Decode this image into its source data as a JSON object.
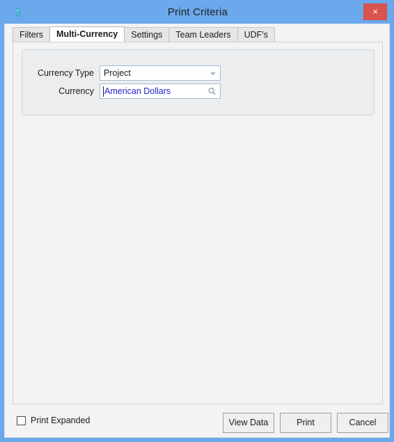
{
  "window": {
    "title": "Print Criteria",
    "app_icon": "bird-icon",
    "close_label": "×",
    "accent_color": "#6ba8ec",
    "close_color": "#d9534f"
  },
  "tabs": [
    {
      "label": "Filters",
      "active": false
    },
    {
      "label": "Multi-Currency",
      "active": true
    },
    {
      "label": "Settings",
      "active": false
    },
    {
      "label": "Team Leaders",
      "active": false
    },
    {
      "label": "UDF's",
      "active": false
    }
  ],
  "form": {
    "currency_type": {
      "label": "Currency Type",
      "value": "Project",
      "control": "dropdown",
      "icon": "chevron-down-icon",
      "options": [
        "Project"
      ]
    },
    "currency": {
      "label": "Currency",
      "value": "American Dollars",
      "control": "lookup",
      "icon": "search-icon",
      "value_color": "#2222cc",
      "focused": true
    }
  },
  "footer": {
    "print_expanded": {
      "label": "Print Expanded",
      "checked": false
    },
    "buttons": [
      {
        "label": "View Data"
      },
      {
        "label": "Print"
      },
      {
        "label": "Cancel"
      }
    ]
  }
}
